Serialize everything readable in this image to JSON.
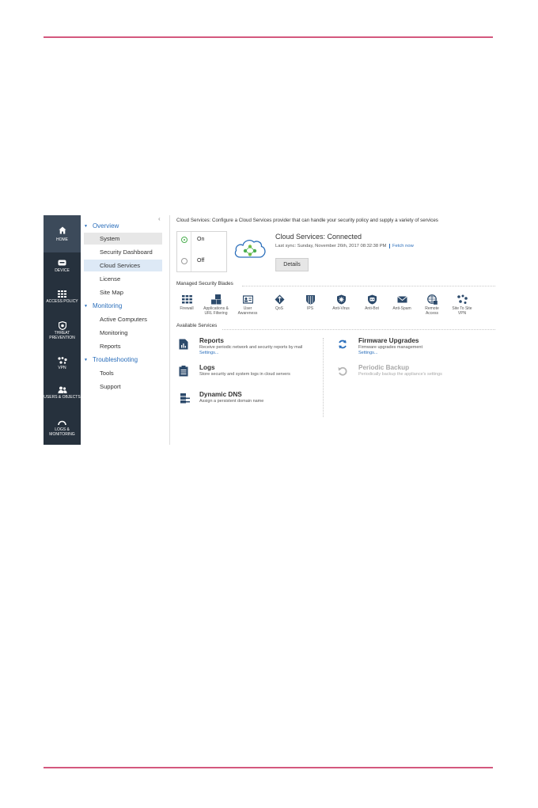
{
  "nav": [
    {
      "label": "HOME",
      "icon": "home-icon",
      "active": true
    },
    {
      "label": "DEVICE",
      "icon": "device-icon"
    },
    {
      "label": "ACCESS POLICY",
      "icon": "access-policy-icon"
    },
    {
      "label": "THREAT PREVENTION",
      "icon": "threat-prevention-icon"
    },
    {
      "label": "VPN",
      "icon": "vpn-icon"
    },
    {
      "label": "USERS & OBJECTS",
      "icon": "users-objects-icon"
    },
    {
      "label": "LOGS & MONITORING",
      "icon": "logs-monitoring-icon"
    }
  ],
  "tree": {
    "collapse": "‹",
    "sections": [
      {
        "label": "Overview",
        "items": [
          "System",
          "Security Dashboard",
          "Cloud Services",
          "License",
          "Site Map"
        ]
      },
      {
        "label": "Monitoring",
        "items": [
          "Active Computers",
          "Monitoring",
          "Reports"
        ]
      },
      {
        "label": "Troubleshooting",
        "items": [
          "Tools",
          "Support"
        ]
      }
    ]
  },
  "content": {
    "description": "Cloud Services: Configure a Cloud Services provider that can handle your security policy and supply a variety of services",
    "toggle": {
      "on": "On",
      "off": "Off",
      "selected": "On"
    },
    "status_title": "Cloud Services: Connected",
    "last_sync": "Last sync: Sunday, November 26th, 2017 08:32:38 PM",
    "fetch_now": "Fetch now",
    "details_label": "Details",
    "blades_heading": "Managed Security Blades",
    "blades": [
      {
        "label": "Firewall",
        "icon": "firewall-icon"
      },
      {
        "label": "Applications & URL Filtering",
        "icon": "app-url-filtering-icon"
      },
      {
        "label": "User Awareness",
        "icon": "user-awareness-icon"
      },
      {
        "label": "QoS",
        "icon": "qos-icon"
      },
      {
        "label": "IPS",
        "icon": "ips-icon"
      },
      {
        "label": "Anti-Virus",
        "icon": "anti-virus-icon"
      },
      {
        "label": "Anti-Bot",
        "icon": "anti-bot-icon"
      },
      {
        "label": "Anti-Spam",
        "icon": "anti-spam-icon"
      },
      {
        "label": "Remote Access",
        "icon": "remote-access-icon"
      },
      {
        "label": "Site To Site VPN",
        "icon": "site-to-site-vpn-icon"
      }
    ],
    "services_heading": "Available Services",
    "services": [
      {
        "title": "Reports",
        "desc": "Receive periodic network and security reports by mail",
        "link": "Settings...",
        "icon": "reports-icon"
      },
      {
        "title": "Logs",
        "desc": "Store security and system logs in cloud servers",
        "icon": "logs-icon"
      },
      {
        "title": "Dynamic DNS",
        "desc": "Assign a persistent domain name",
        "icon": "dynamic-dns-icon"
      },
      {
        "title": "Firmware Upgrades",
        "desc": "Firmware upgrades management",
        "link": "Settings...",
        "icon": "firmware-upgrades-icon"
      },
      {
        "title": "Periodic Backup",
        "desc": "Periodically backup the appliance's settings",
        "icon": "periodic-backup-icon",
        "disabled": true
      }
    ]
  },
  "colors": {
    "accent_rule": "#d4587e",
    "nav_bg": "#26313d",
    "link": "#2a6ebb",
    "connected_green": "#4caf50"
  }
}
